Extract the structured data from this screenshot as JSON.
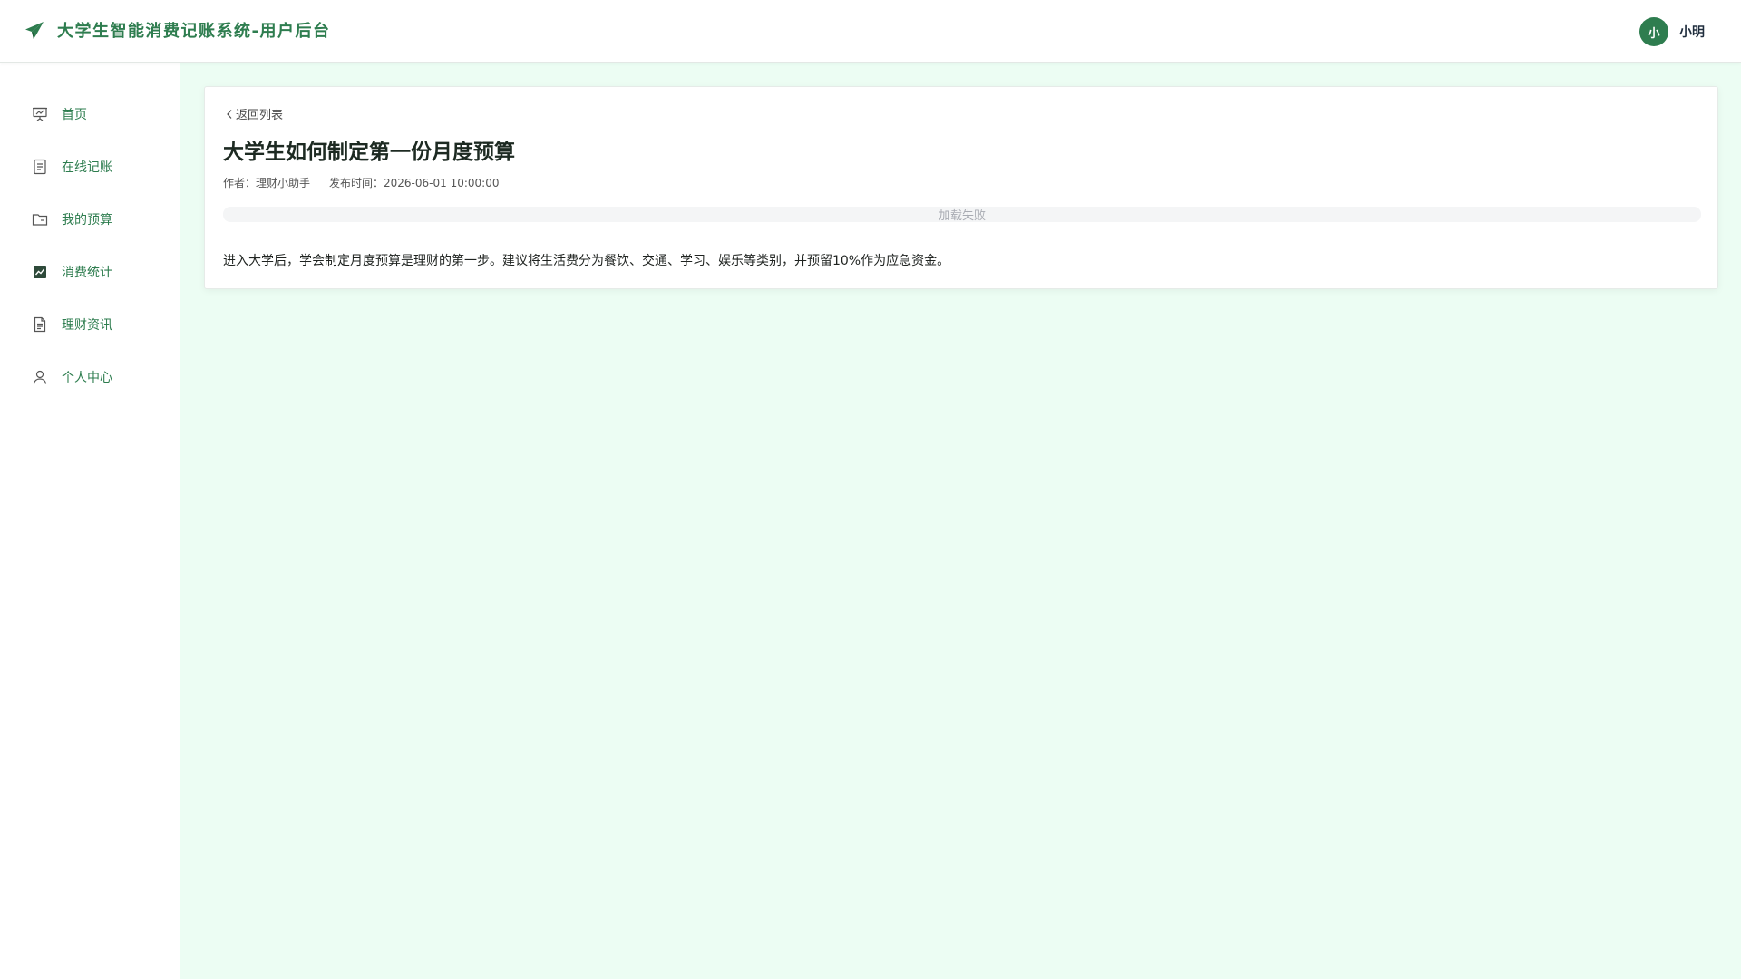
{
  "header": {
    "app_title": "大学生智能消费记账系统-用户后台",
    "logo_icon": "paper-plane-icon",
    "brand_color": "#2e7d4f",
    "user": {
      "avatar_text": "小",
      "username": "小明"
    }
  },
  "sidebar": {
    "items": [
      {
        "label": "首页",
        "icon": "presentation-icon"
      },
      {
        "label": "在线记账",
        "icon": "document-icon"
      },
      {
        "label": "我的预算",
        "icon": "folder-icon"
      },
      {
        "label": "消费统计",
        "icon": "chart-icon"
      },
      {
        "label": "理财资讯",
        "icon": "file-text-icon"
      },
      {
        "label": "个人中心",
        "icon": "user-icon"
      }
    ]
  },
  "article": {
    "back_label": "返回列表",
    "title": "大学生如何制定第一份月度预算",
    "author": "作者：理财小助手",
    "publish_time": "发布时间：2026-06-01 10:00:00",
    "image_status": "加载失败",
    "content": "进入大学后，学会制定月度预算是理财的第一步。建议将生活费分为餐饮、交通、学习、娱乐等类别，并预留10%作为应急资金。"
  },
  "colors": {
    "page_background": "#ecfdf3",
    "accent": "#2e7d4f"
  }
}
